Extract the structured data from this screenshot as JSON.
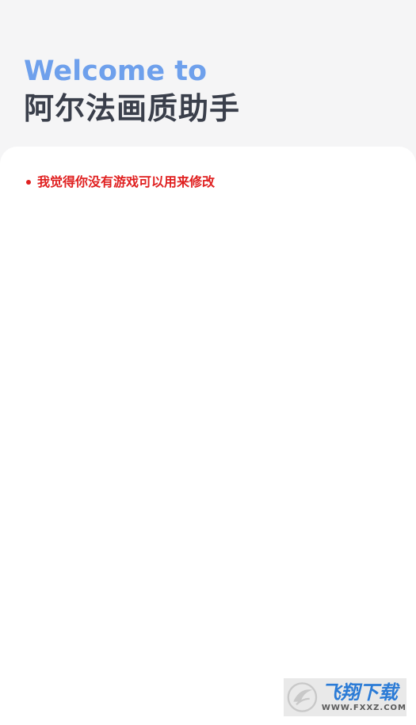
{
  "header": {
    "welcome": "Welcome to",
    "app_name": "阿尔法画质助手"
  },
  "content": {
    "notice": "我觉得你没有游戏可以用来修改"
  },
  "watermark": {
    "title": "飞翔下载",
    "url": "WWW.FXXZ.COM"
  },
  "colors": {
    "welcome": "#6ea0ec",
    "app_name": "#3a3f4b",
    "notice": "#e02020",
    "watermark_title": "#2b7bd6",
    "watermark_url": "#5a5a5a",
    "logo": "#c8c8c8"
  }
}
